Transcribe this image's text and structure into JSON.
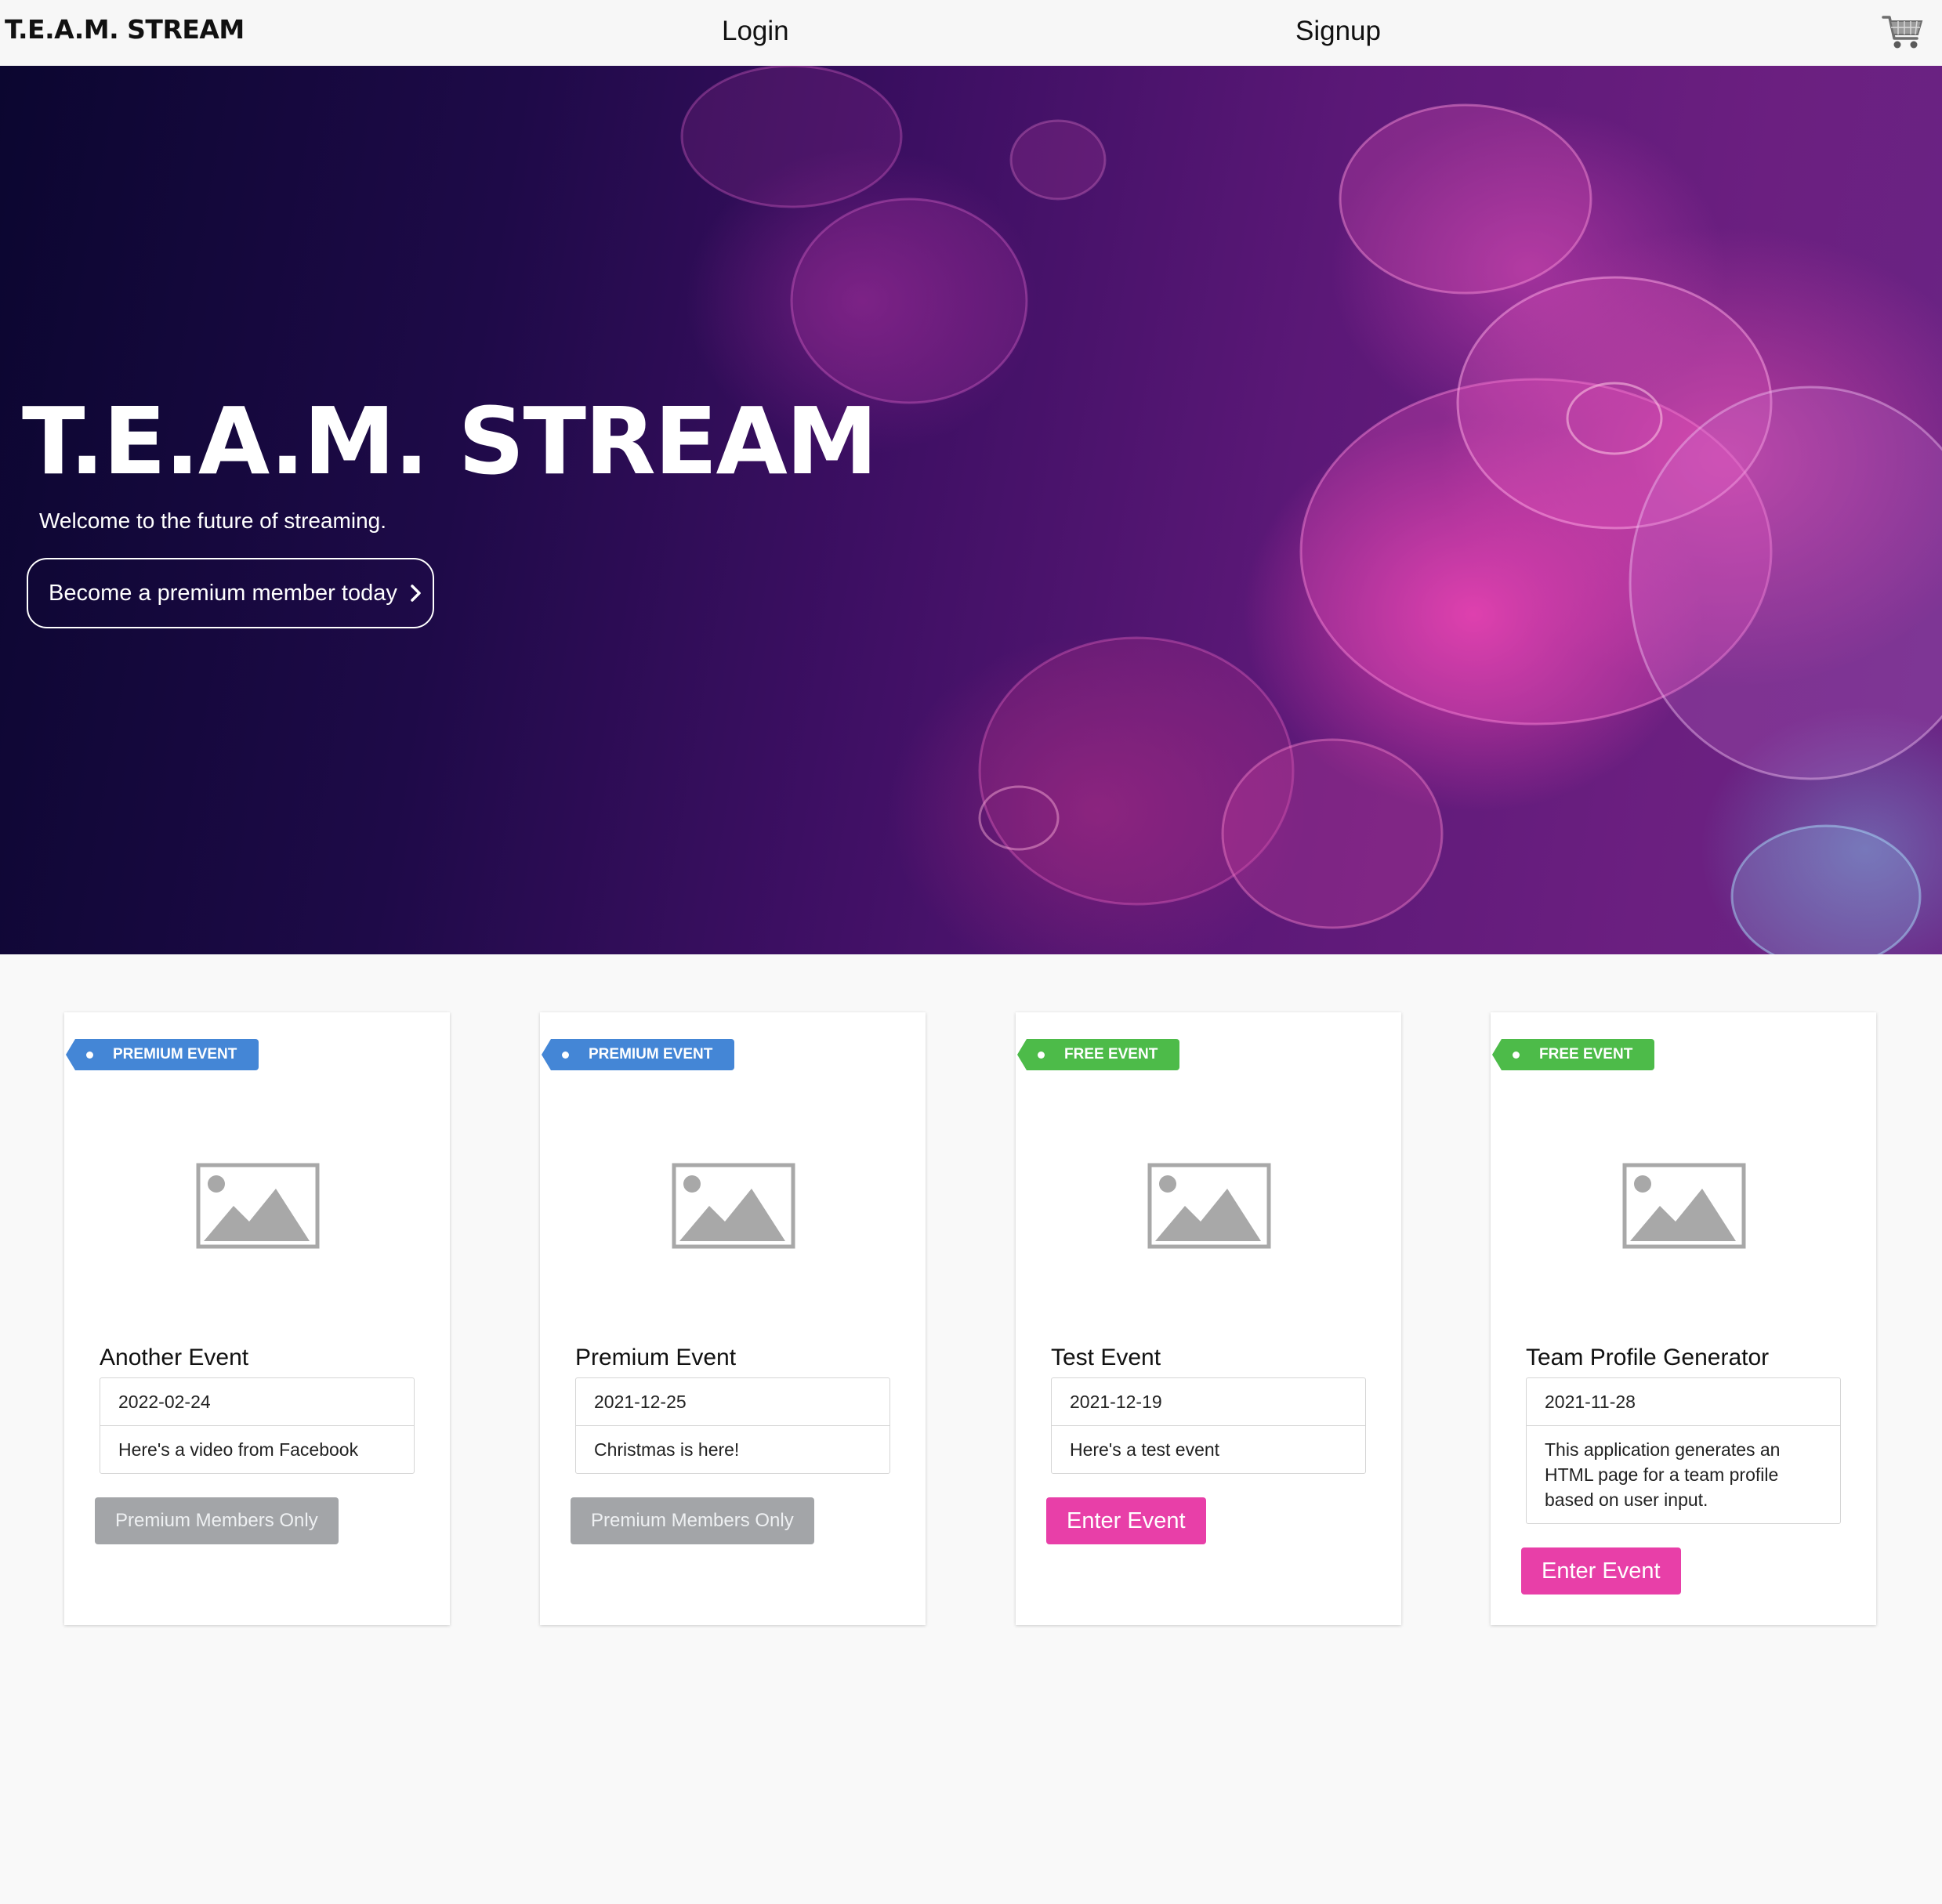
{
  "navbar": {
    "brand": "T.E.A.M. STREAM",
    "login": "Login",
    "signup": "Signup",
    "cart_icon": "shopping-cart-icon"
  },
  "hero": {
    "title": "T.E.A.M. STREAM",
    "subtitle": "Welcome to the future of streaming.",
    "cta": "Become a premium member today",
    "cta_icon": "chevron-right-icon"
  },
  "colors": {
    "premium_badge": "#4486d6",
    "free_badge": "#4dbb49",
    "enter_button": "#e83fa8",
    "disabled_button": "#a3a5a8"
  },
  "events": [
    {
      "badge": "PREMIUM EVENT",
      "title": "Another Event",
      "date": "2022-02-24",
      "description": "Here's a video from Facebook",
      "button": "Premium Members Only"
    },
    {
      "badge": "PREMIUM EVENT",
      "title": "Premium Event",
      "date": "2021-12-25",
      "description": "Christmas is here!",
      "button": "Premium Members Only"
    },
    {
      "badge": "FREE EVENT",
      "title": "Test Event",
      "date": "2021-12-19",
      "description": "Here's a test event",
      "button": "Enter Event"
    },
    {
      "badge": "FREE EVENT",
      "title": "Team Profile Generator",
      "date": "2021-11-28",
      "description": "This application generates an HTML page for a team profile based on user input.",
      "button": "Enter Event"
    }
  ]
}
